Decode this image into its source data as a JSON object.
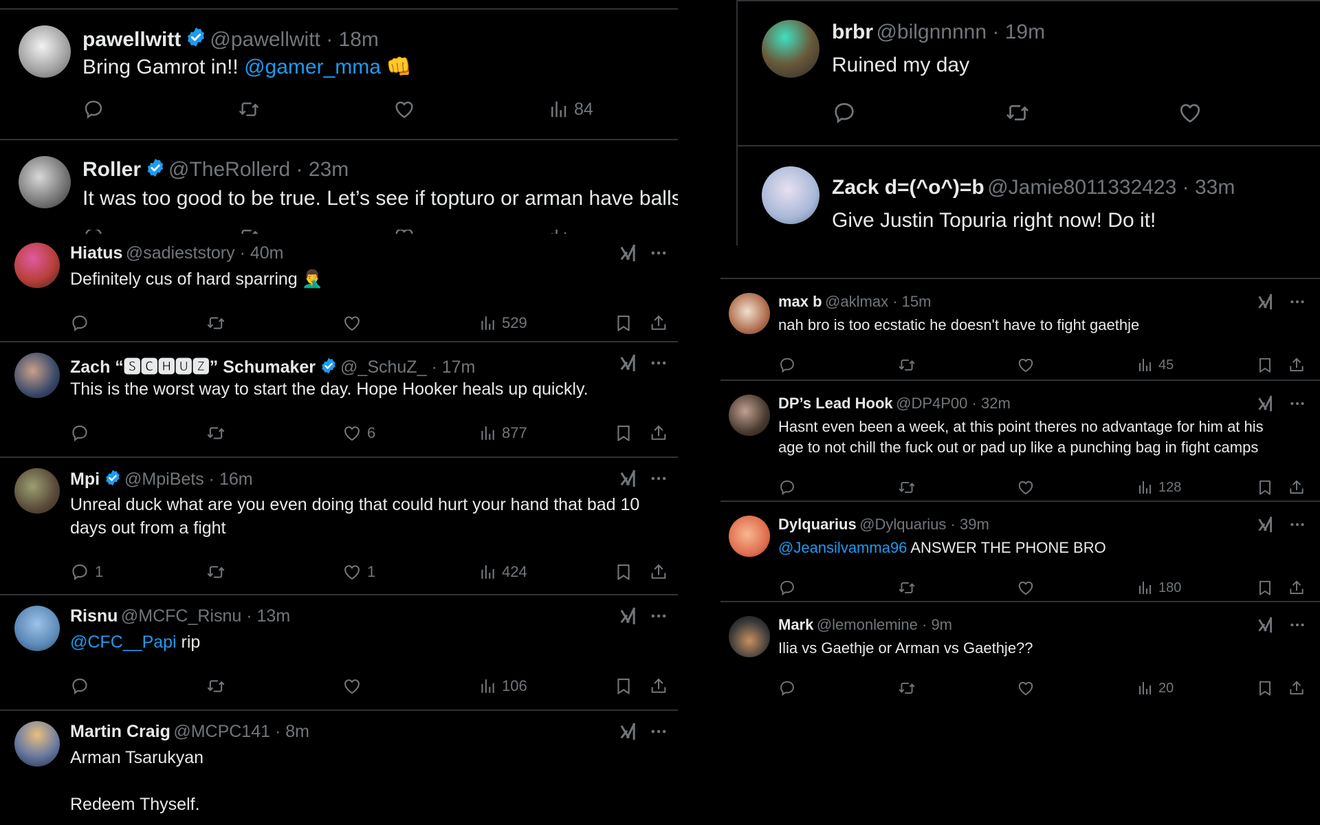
{
  "colors": {
    "background": "#000000",
    "text": "#e7e9ea",
    "muted": "#71767b",
    "accent": "#1d9bf0",
    "divider": "#2f3336"
  },
  "left_top": [
    {
      "name": "pawellwitt",
      "verified": true,
      "handle": "@pawellwitt",
      "time": "18m",
      "text": "Bring Gamrot in!! ",
      "mention": "@gamer_mma",
      "emoji": "👊",
      "reply_count": "",
      "repost_count": "",
      "like_count": "",
      "views": "84"
    },
    {
      "name": "Roller",
      "verified": true,
      "handle": "@TheRollerd",
      "time": "23m",
      "text": "It was too good to be true. Let’s see if topturo or arman have balls."
    }
  ],
  "left_feed": [
    {
      "name": "Hiatus",
      "verified": false,
      "handle": "@sadieststory",
      "time": "40m",
      "lines": [
        "Definitely cus of hard sparring"
      ],
      "emoji": "🤦‍♂️",
      "reply_count": "",
      "like_count": "",
      "views": "529"
    },
    {
      "name": "Zach “🆂🅲🅷🆄🆉” Schumaker",
      "verified": true,
      "handle": "@_SchuZ_",
      "time": "17m",
      "lines": [
        "This is the worst way to start the day. Hope Hooker heals up quickly."
      ],
      "reply_count": "",
      "like_count": "6",
      "views": "877"
    },
    {
      "name": "Mpi",
      "verified": true,
      "handle": "@MpiBets",
      "time": "16m",
      "lines": [
        "Unreal duck what are you even doing that could hurt your hand that bad 10",
        "days out from a fight"
      ],
      "reply_count": "1",
      "like_count": "1",
      "views": "424"
    },
    {
      "name": "Risnu",
      "verified": false,
      "handle": "@MCFC_Risnu",
      "time": "13m",
      "mention": "@CFC__Papi",
      "lines": [
        " rip"
      ],
      "reply_count": "",
      "like_count": "",
      "views": "106"
    },
    {
      "name": "Martin Craig",
      "verified": false,
      "handle": "@MCPC141",
      "time": "8m",
      "lines": [
        "Arman Tsarukyan",
        "",
        "Redeem Thyself."
      ]
    }
  ],
  "right_top": [
    {
      "name": "brbr",
      "handle": "@bilgnnnnn",
      "time": "19m",
      "text": "Ruined my day"
    },
    {
      "name": "Zack d=(^o^)=b",
      "handle": "@Jamie8011332423",
      "time": "33m",
      "text": "Give Justin Topuria right now! Do it!"
    }
  ],
  "right_feed": [
    {
      "name": "max b",
      "handle": "@aklmax",
      "time": "15m",
      "lines": [
        "nah bro is too ecstatic he doesn't have to fight gaethje"
      ],
      "views": "45"
    },
    {
      "name": "DP’s Lead Hook",
      "handle": "@DP4P00",
      "time": "32m",
      "lines": [
        "Hasnt even been a week, at this point theres no advantage for him at his",
        "age to not chill the fuck out or pad up like a punching bag in fight camps"
      ],
      "views": "128"
    },
    {
      "name": "Dylquarius",
      "handle": "@Dylquarius",
      "time": "39m",
      "mention": "@Jeansilvamma96",
      "lines": [
        " ANSWER THE PHONE BRO"
      ],
      "views": "180"
    },
    {
      "name": "Mark",
      "handle": "@lemonlemine",
      "time": "9m",
      "lines": [
        "Ilia vs Gaethje or Arman vs Gaethje??"
      ],
      "views": "20"
    }
  ],
  "icons": {
    "reply": "reply-icon",
    "repost": "repost-icon",
    "like": "like-icon",
    "views": "views-icon",
    "bookmark": "bookmark-icon",
    "share": "share-icon",
    "grok": "grok-icon",
    "more": "more-icon",
    "verified": "verified-badge-icon"
  }
}
